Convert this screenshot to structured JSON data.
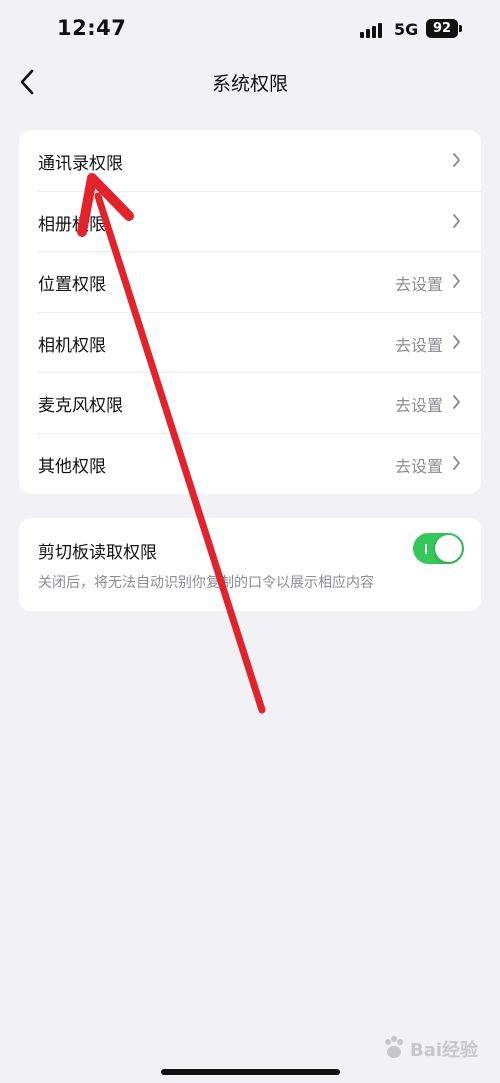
{
  "status_bar": {
    "time": "12:47",
    "network": "5G",
    "battery": "92"
  },
  "nav": {
    "title": "系统权限"
  },
  "permissions": [
    {
      "label": "通讯录权限",
      "status": ""
    },
    {
      "label": "相册权限",
      "status": ""
    },
    {
      "label": "位置权限",
      "status": "去设置"
    },
    {
      "label": "相机权限",
      "status": "去设置"
    },
    {
      "label": "麦克风权限",
      "status": "去设置"
    },
    {
      "label": "其他权限",
      "status": "去设置"
    }
  ],
  "clipboard": {
    "title": "剪切板读取权限",
    "description": "关闭后，将无法自动识别你复制的口令以展示相应内容",
    "enabled": true
  },
  "watermark": {
    "text": "Bai经验"
  },
  "colors": {
    "accent_green": "#34c759",
    "arrow_red": "#e3232c",
    "background": "#f2f2f6"
  }
}
